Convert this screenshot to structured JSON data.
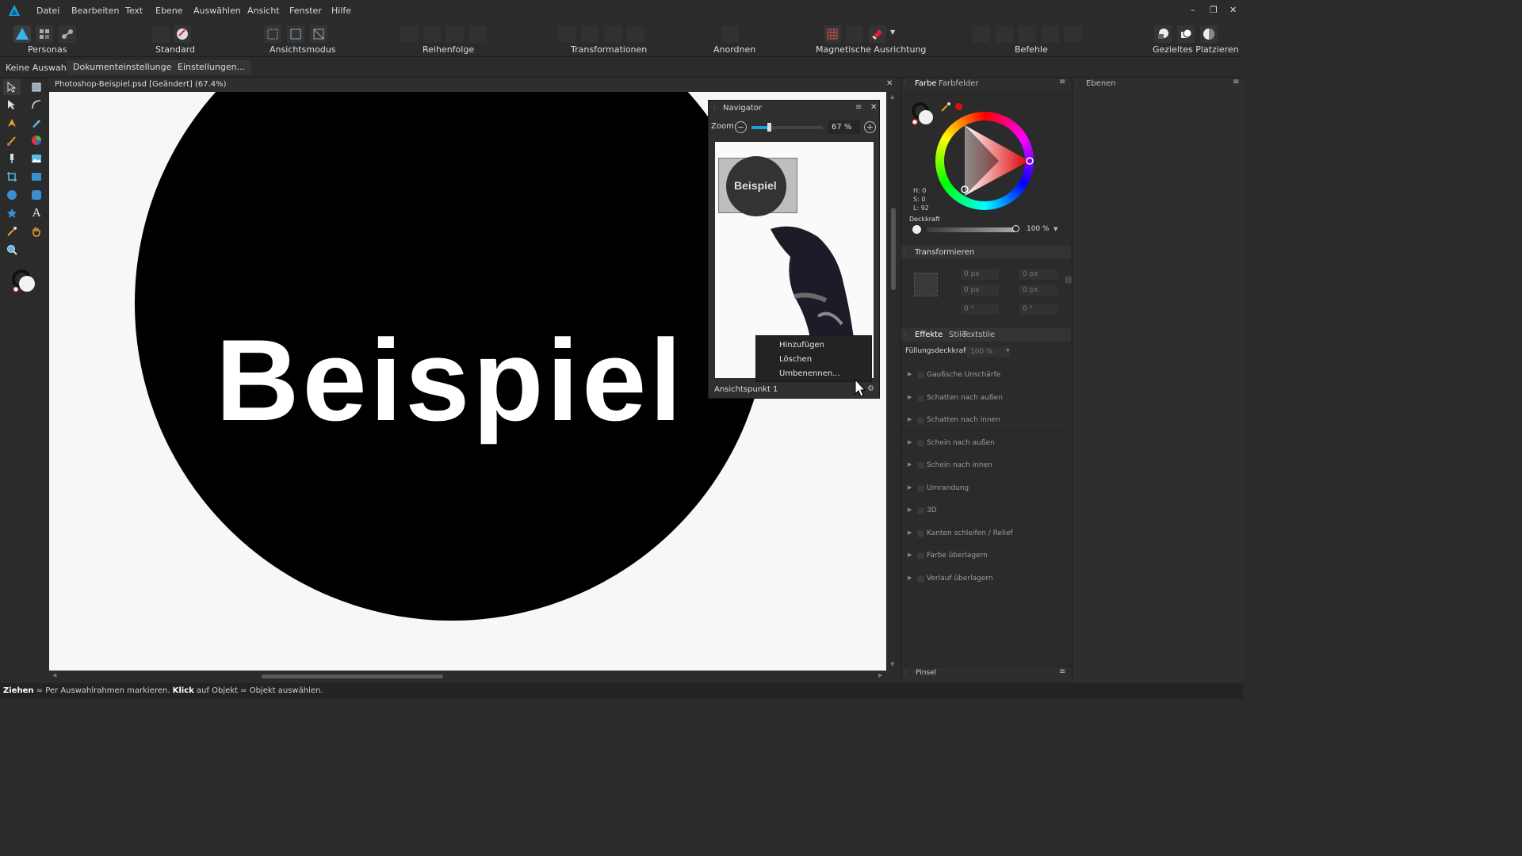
{
  "menubar": {
    "items": [
      "Datei",
      "Bearbeiten",
      "Text",
      "Ebene",
      "Auswählen",
      "Ansicht",
      "Fenster",
      "Hilfe"
    ],
    "window_controls": [
      "–",
      "❐",
      "✕"
    ]
  },
  "toolbar": {
    "groups": [
      {
        "label": "Personas"
      },
      {
        "label": "Standard"
      },
      {
        "label": "Ansichtsmodus"
      },
      {
        "label": "Reihenfolge"
      },
      {
        "label": "Transformationen"
      },
      {
        "label": "Anordnen"
      },
      {
        "label": "Magnetische Ausrichtung"
      },
      {
        "label": "Befehle"
      },
      {
        "label": "Gezieltes Platzieren"
      }
    ]
  },
  "contextbar": {
    "selection": "Keine Auswahl",
    "document_settings": "Dokumenteinstellungen...",
    "settings": "Einstellungen..."
  },
  "document": {
    "tab_title": "Photoshop-Beispiel.psd [Geändert] (67.4%)",
    "close": "✕",
    "canvas_text": "Beispiel"
  },
  "navigator": {
    "title": "Navigator",
    "zoom_label": "Zoom:",
    "zoom_value": "67 %",
    "zoom_level": 0.67,
    "preview_text": "Beispiel",
    "viewpoint": "Ansichtspunkt 1",
    "context_menu": [
      "Hinzufügen",
      "Löschen",
      "Umbenennen..."
    ]
  },
  "color_panel": {
    "tabs": [
      "Farbe",
      "Farbfelder"
    ],
    "h": "H: 0",
    "s": "S: 0",
    "l": "L: 92",
    "opacity_label": "Deckkraft",
    "opacity_value": "100 %"
  },
  "layers_panel": {
    "title": "Ebenen"
  },
  "transform_panel": {
    "title": "Transformieren",
    "x": "0 px",
    "y": "0 px",
    "w": "0 px",
    "h": "0 px",
    "r": "0 °",
    "s": "0 °"
  },
  "effects_panel": {
    "tabs": [
      "Effekte",
      "Stile",
      "Textstile"
    ],
    "fill_opacity_label": "Füllungsdeckkraft:",
    "fill_opacity_value": "100 %",
    "effects": [
      "Gaußsche Unschärfe",
      "Schatten nach außen",
      "Schatten nach innen",
      "Schein nach außen",
      "Schein nach innen",
      "Umrandung",
      "3D",
      "Kanten schleifen / Relief",
      "Farbe überlagern",
      "Verlauf überlagern"
    ]
  },
  "brush_panel": {
    "title": "Pinsel"
  },
  "statusbar": {
    "drag": "Ziehen",
    "drag_text": " = Per Auswahlrahmen markieren. ",
    "click": "Klick",
    "click_text": " auf Objekt = Objekt auswählen."
  },
  "colors": {
    "accent": "#1d9fd8",
    "panel": "#2b2b2b",
    "canvas": "#f7f7f7"
  }
}
